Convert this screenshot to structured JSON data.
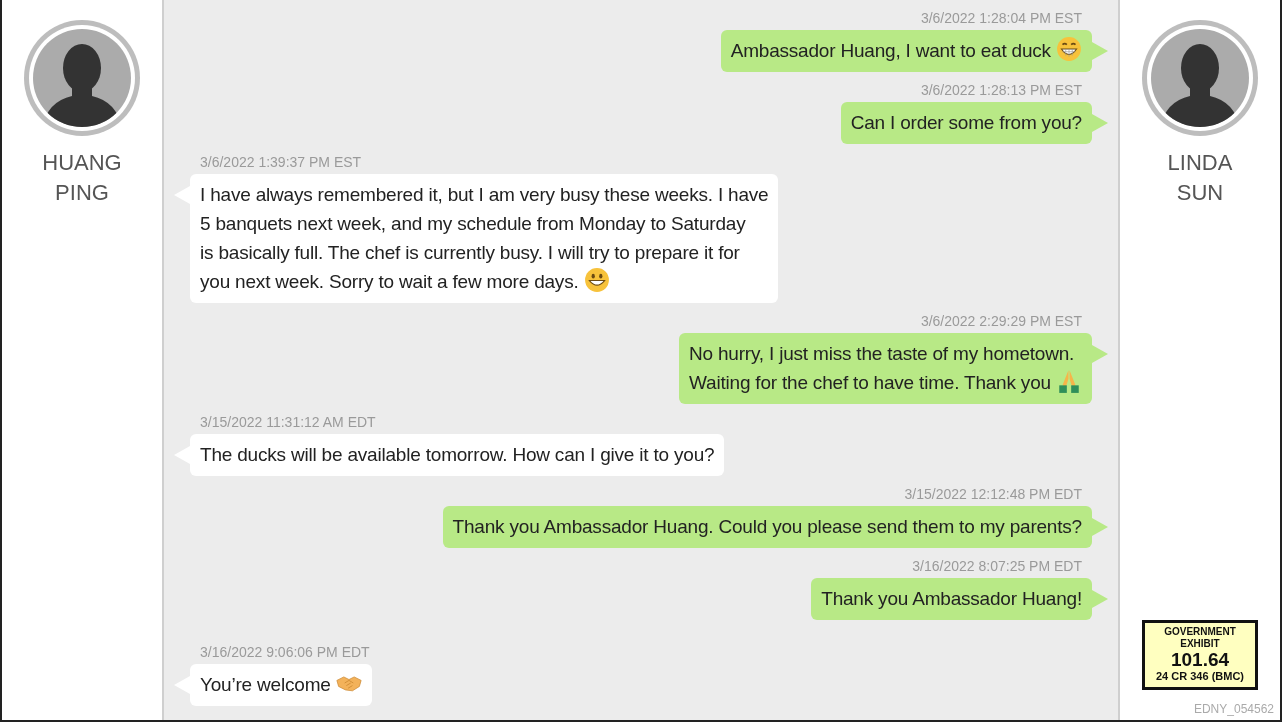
{
  "left_contact": {
    "name": "HUANG\nPING"
  },
  "messages": [
    {
      "kind": "out",
      "timestamp": "3/6/2022 1:28:04 PM EST",
      "text": "Ambassador Huang, I want to eat duck",
      "has_emoji": true
    },
    {
      "kind": "out",
      "timestamp": "3/6/2022 1:28:13 PM EST",
      "text": "Can I order some from you?"
    },
    {
      "kind": "in",
      "timestamp": "3/6/2022 1:39:37 PM EST",
      "text": "I have always remembered it, but I am very busy these weeks. I have\n5 banquets next week, and my schedule from Monday to Saturday\nis basically full. The chef is currently busy. I will try to prepare it for\nyou next week. Sorry to wait a few more days.",
      "has_emoji": true
    },
    {
      "kind": "out",
      "timestamp": "3/6/2022 2:29:29 PM EST",
      "text": "No hurry, I just miss the taste of my hometown.\nWaiting for the chef to have time. Thank you",
      "has_emoji": true
    },
    {
      "kind": "in",
      "timestamp": "3/15/2022 11:31:12 AM EDT",
      "text": "The ducks will be available tomorrow. How can I give it to you?"
    },
    {
      "kind": "out",
      "timestamp": "3/15/2022 12:12:48 PM EDT",
      "text": "Thank you Ambassador Huang. Could you please send them to my parents?"
    },
    {
      "kind": "out",
      "timestamp": "3/16/2022 8:07:25 PM EDT",
      "text": "Thank you Ambassador Huang!"
    },
    {
      "kind": "in",
      "timestamp": "3/16/2022 9:06:06 PM EDT",
      "text": "You’re welcome",
      "has_emoji": true
    }
  ],
  "right_contact": {
    "name": "LINDA\nSUN"
  },
  "exhibit_sticker": {
    "heading": "GOVERNMENT\nEXHIBIT",
    "number": "101.64",
    "case": "24 CR 346 (BMC)"
  },
  "bates_number": "EDNY_054562"
}
